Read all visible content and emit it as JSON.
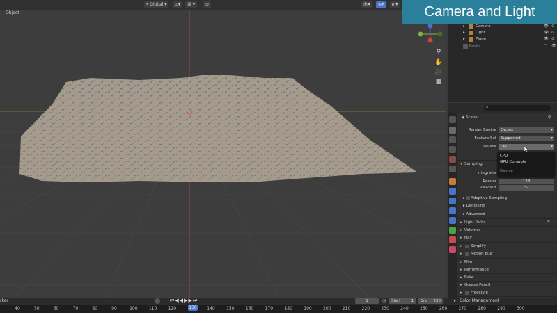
{
  "banner": {
    "title": "Camera and Light"
  },
  "viewport": {
    "header": {
      "transform_orientation": "Global"
    },
    "sub_header": {
      "menu_object": "Object"
    }
  },
  "outliner": {
    "rows": [
      {
        "name": "Camera",
        "icon": "camera-icon"
      },
      {
        "name": "Light",
        "icon": "light-icon"
      },
      {
        "name": "Plane",
        "icon": "mesh-icon"
      },
      {
        "name": "Rocks",
        "icon": "collection-icon"
      }
    ]
  },
  "properties": {
    "scene_label": "Scene",
    "render_engine": {
      "label": "Render Engine",
      "value": "Cycles"
    },
    "feature_set": {
      "label": "Feature Set",
      "value": "Supported"
    },
    "device": {
      "label": "Device",
      "value": "CPU"
    },
    "device_dropdown": {
      "options": [
        "CPU",
        "GPU Compute"
      ],
      "hint": "Device"
    },
    "sampling": {
      "label": "Sampling",
      "integrator_label": "Integrator",
      "render_label": "Render",
      "render_value": "128",
      "viewport_label": "Viewport",
      "viewport_value": "32",
      "adaptive_sampling": "Adaptive Sampling",
      "denoising": "Denoising",
      "advanced": "Advanced"
    },
    "panels": [
      {
        "label": "Light Paths",
        "checkbox": false
      },
      {
        "label": "Volumes",
        "checkbox": false
      },
      {
        "label": "Hair",
        "checkbox": false
      },
      {
        "label": "Simplify",
        "checkbox": true
      },
      {
        "label": "Motion Blur",
        "checkbox": true
      },
      {
        "label": "Film",
        "checkbox": false
      },
      {
        "label": "Performance",
        "checkbox": false
      },
      {
        "label": "Bake",
        "checkbox": false
      },
      {
        "label": "Grease Pencil",
        "checkbox": false
      },
      {
        "label": "Freestyle",
        "checkbox": true
      },
      {
        "label": "Color Management",
        "checkbox": false
      }
    ]
  },
  "timeline": {
    "marker_label": "rker",
    "current_frame": "1",
    "start_label": "Start",
    "start_value": "1",
    "end_label": "End",
    "end_value": "250",
    "playhead_frame": "130",
    "ticks": [
      "40",
      "50",
      "60",
      "70",
      "80",
      "90",
      "100",
      "110",
      "120",
      "130",
      "140",
      "150",
      "160",
      "170",
      "180",
      "190",
      "200",
      "210",
      "220",
      "230",
      "240",
      "250",
      "260",
      "270",
      "280",
      "290",
      "300"
    ]
  },
  "colors": {
    "banner_bg": "#2a7f9a",
    "axis_red": "#c8463e",
    "axis_green": "#7ab34a",
    "terrain": "#a69a8a",
    "rocks": "#6f7b8c",
    "playhead": "#4a74c9"
  }
}
